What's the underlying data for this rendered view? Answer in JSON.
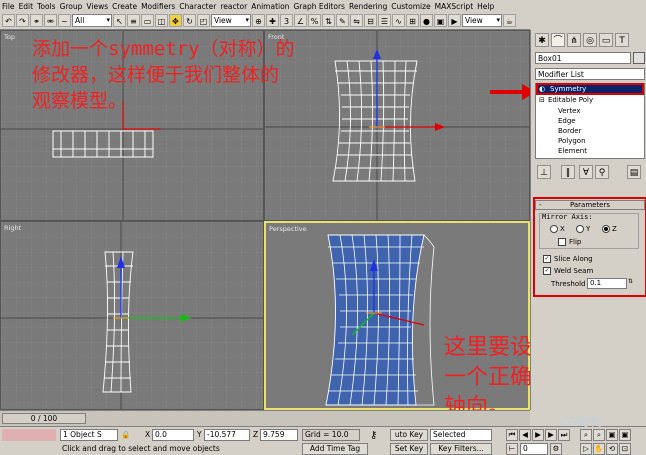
{
  "menu": [
    "File",
    "Edit",
    "Tools",
    "Group",
    "Views",
    "Create",
    "Modifiers",
    "Character",
    "reactor",
    "Animation",
    "Graph Editors",
    "Rendering",
    "Customize",
    "MAXScript",
    "Help"
  ],
  "toolbar": {
    "selection_filter": "All",
    "ref_coord": "View",
    "ref_coord_right": "View"
  },
  "viewports": {
    "top": {
      "label": "Top"
    },
    "front": {
      "label": "Front"
    },
    "left": {
      "label": "Right"
    },
    "perspective": {
      "label": "Perspective"
    }
  },
  "annotations": {
    "top_line1": "添加一个symmetry（对称）的",
    "top_line2": "修改器，这样便于我们整体的",
    "top_line3": "观察模型。",
    "bottom_line1": "这里要设置",
    "bottom_line2": "一个正确的",
    "bottom_line3": "轴向。"
  },
  "command_panel": {
    "object_name": "Box01",
    "modifier_list": "Modifier List",
    "stack": [
      "Symmetry",
      "Editable Poly",
      "Vertex",
      "Edge",
      "Border",
      "Polygon",
      "Element"
    ],
    "rollout_title": "Parameters",
    "mirror_axis_label": "Mirror Axis:",
    "axis_options": [
      "X",
      "Y",
      "Z"
    ],
    "selected_axis": "Z",
    "flip_label": "Flip",
    "slice_along_label": "Slice Along",
    "weld_seam_label": "Weld Seam",
    "threshold_label": "Threshold",
    "threshold_value": "0.1",
    "flip_checked": false,
    "slice_checked": true,
    "weld_checked": true
  },
  "timeline": {
    "frame": "0 / 100"
  },
  "status": {
    "selection": "1 Object S",
    "x_label": "X",
    "x_value": "0.0",
    "y_label": "Y",
    "y_value": "-10.577",
    "z_label": "Z",
    "z_value": "9.759",
    "grid": "Grid = 10.0",
    "auto_key": "uto Key",
    "selected": "Selected",
    "set_key": "Set Key",
    "key_filters": "Key Filters...",
    "prompt": "Click and drag to select and move objects",
    "add_time_tag": "Add Time Tag",
    "frame_value": "0",
    "watermark": "CG时代"
  },
  "colors": {
    "annotation": "#ee2222",
    "viewport_bg": "#7a7a7a",
    "active_viewport_border": "#e8e070",
    "mesh_blue": "#4a6fb5"
  }
}
